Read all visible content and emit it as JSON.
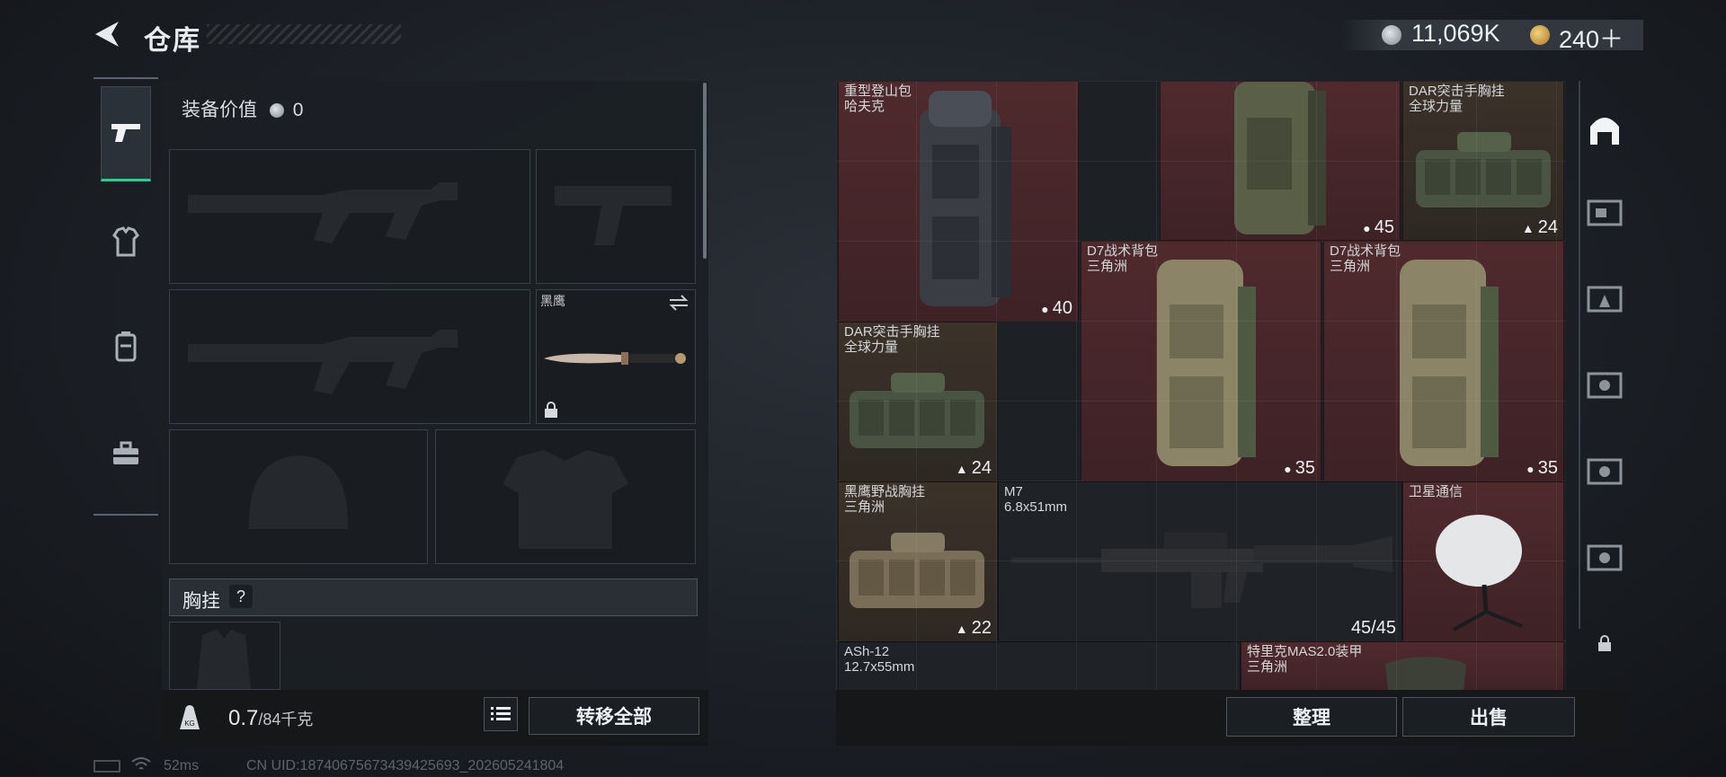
{
  "header": {
    "title": "仓库"
  },
  "currency": {
    "silver": "11,069K",
    "gold": "240＋"
  },
  "equipment": {
    "value_label": "装备价值",
    "value": "0",
    "melee_name": "黑鹰",
    "chest_rig_label": "胸挂",
    "chest_rig_help": "?"
  },
  "footer": {
    "weight_current": "0.7",
    "weight_max": "/84千克",
    "transfer_all": "转移全部",
    "sort": "整理",
    "sell": "出售"
  },
  "status_bar": {
    "ping": "52ms",
    "uid": "CN UID:187406756734394256​93_202605241804"
  },
  "inventory": [
    {
      "id": "pack1",
      "name": "重型登山包",
      "sub": "哈夫克",
      "badge": "40"
    },
    {
      "id": "pack2",
      "name": "",
      "sub": "",
      "badge": "45"
    },
    {
      "id": "rig1",
      "name": "DAR突击手胸挂",
      "sub": "全球力量",
      "badge": "24"
    },
    {
      "id": "pack3",
      "name": "D7战术背包",
      "sub": "三角洲",
      "badge": "35"
    },
    {
      "id": "pack4",
      "name": "D7战术背包",
      "sub": "三角洲",
      "badge": "35"
    },
    {
      "id": "rig2",
      "name": "DAR突击手胸挂",
      "sub": "全球力量",
      "badge": "24"
    },
    {
      "id": "rig3",
      "name": "黑鹰野战胸挂",
      "sub": "三角洲",
      "badge": "22"
    },
    {
      "id": "m7",
      "name": "M7",
      "sub": "6.8x51mm",
      "badge": "45/45"
    },
    {
      "id": "sat",
      "name": "卫星通信",
      "sub": "",
      "badge": ""
    },
    {
      "id": "ash",
      "name": "ASh-12",
      "sub": "12.7x55mm",
      "badge": ""
    },
    {
      "id": "armor",
      "name": "特里克MAS2.0装甲",
      "sub": "三角洲",
      "badge": ""
    }
  ]
}
